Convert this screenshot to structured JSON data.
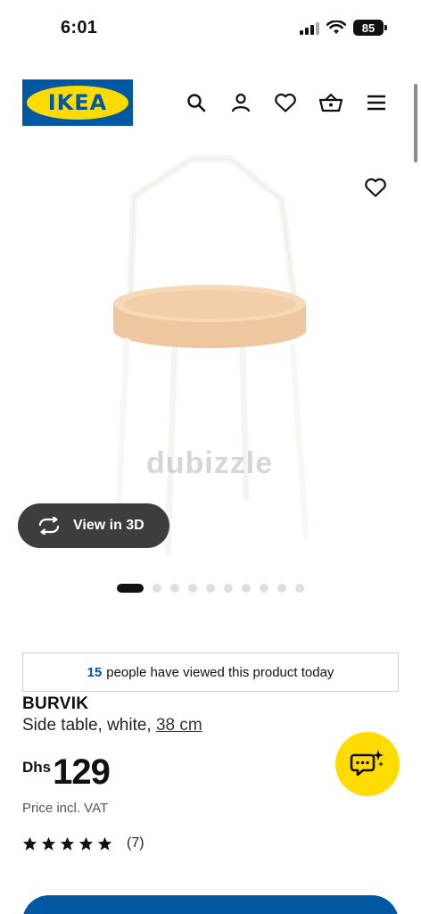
{
  "status_bar": {
    "time": "6:01",
    "battery": "85"
  },
  "header": {
    "logo_text": "IKEA"
  },
  "gallery": {
    "watermark": "dubizzle",
    "view_3d_label": "View in 3D",
    "total_images": 11,
    "active_image": 1
  },
  "viewed": {
    "count": "15",
    "text": "people have viewed this product today"
  },
  "product": {
    "name": "BURVIK",
    "description": "Side table, white,",
    "size": "38 cm",
    "currency": "Dhs",
    "price": "129",
    "vat_note": "Price incl. VAT",
    "rating": 5,
    "review_count": "(7)"
  },
  "colors": {
    "ikea_blue": "#0058a3",
    "ikea_yellow": "#ffdb00"
  }
}
